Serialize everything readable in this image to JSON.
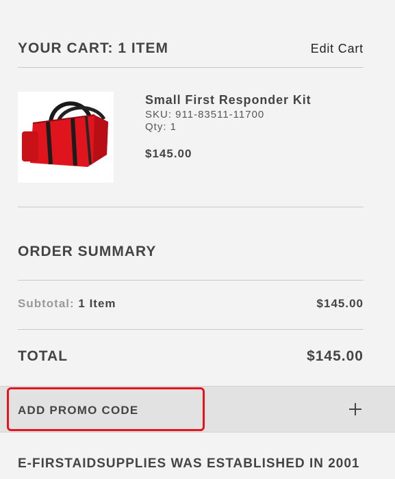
{
  "cart": {
    "title": "YOUR CART: 1 ITEM",
    "edit_label": "Edit Cart"
  },
  "product": {
    "name": "Small First Responder Kit",
    "sku": "SKU: 911-83511-11700",
    "qty": "Qty: 1",
    "price": "$145.00",
    "image_icon": "red-bag-image"
  },
  "summary": {
    "title": "ORDER SUMMARY",
    "subtotal_label": "Subtotal:",
    "subtotal_count": "1 Item",
    "subtotal_value": "$145.00",
    "total_label": "TOTAL",
    "total_value": "$145.00"
  },
  "promo": {
    "label": "ADD PROMO CODE",
    "icon": "plus-icon",
    "highlight_color": "#e4141e"
  },
  "footer": {
    "text": "E-FIRSTAIDSUPPLIES WAS ESTABLISHED IN 2001"
  }
}
